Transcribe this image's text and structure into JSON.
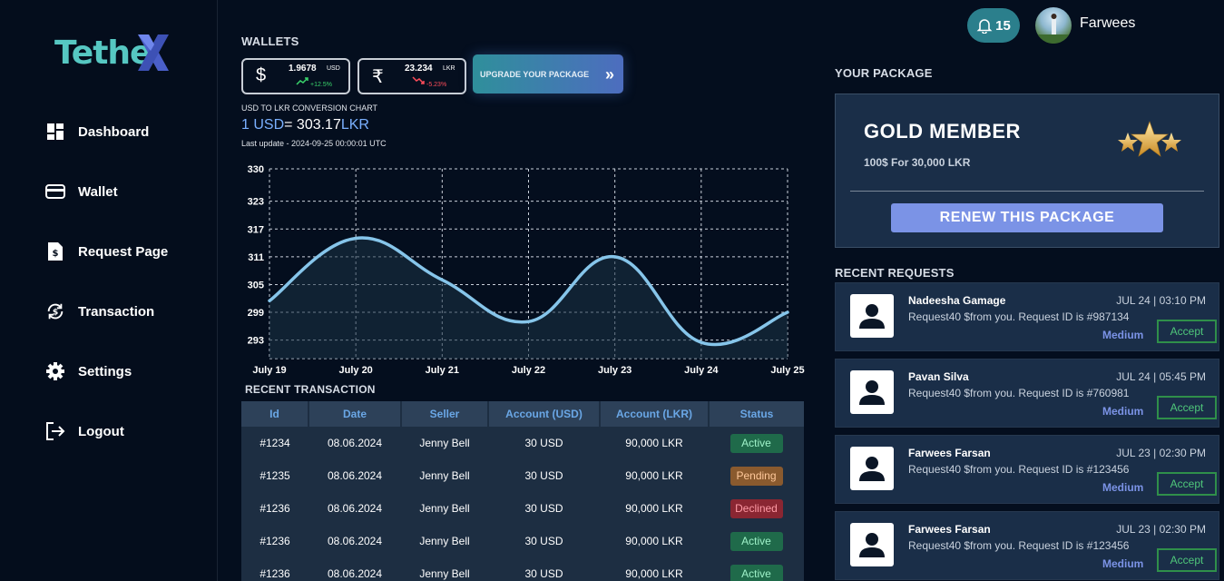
{
  "app": {
    "logo_text": "Tethe",
    "logo_letter": "X"
  },
  "sidebar": {
    "items": [
      {
        "label": "Dashboard",
        "icon": "dashboard-icon"
      },
      {
        "label": "Wallet",
        "icon": "wallet-icon"
      },
      {
        "label": "Request Page",
        "icon": "request-page-icon"
      },
      {
        "label": "Transaction",
        "icon": "transaction-icon"
      },
      {
        "label": "Settings",
        "icon": "settings-icon"
      },
      {
        "label": "Logout",
        "icon": "logout-icon"
      }
    ]
  },
  "wallets": {
    "title": "WALLETS",
    "cards": [
      {
        "symbol": "$",
        "amount": "1.9678",
        "currency": "USD",
        "change": "+12.5%",
        "change_color": "#39d36b"
      },
      {
        "symbol": "₹",
        "amount": "23.234",
        "currency": "LKR",
        "change": "-5.23%",
        "change_color": "#ff4d5a"
      }
    ],
    "upgrade_label": "UPGRADE YOUR PACKAGE"
  },
  "conversion": {
    "title": "USD TO LKR CONVERSION CHART",
    "from": "1 USD",
    "eq": "= 303.17",
    "to": "LKR",
    "last_update": "Last update - 2024-09-25 00:00:01 UTC"
  },
  "chart_data": {
    "type": "area",
    "categories": [
      "July 19",
      "July 20",
      "July 21",
      "July 22",
      "July 23",
      "July 24",
      "July 25"
    ],
    "y_ticks": [
      330,
      323,
      317,
      311,
      305,
      299,
      293
    ],
    "ylim": [
      289,
      330
    ],
    "series": [
      {
        "values": [
          301.5,
          315,
          306,
          297,
          311,
          292.5,
          299
        ]
      }
    ],
    "line_color": "#86c5ea",
    "grid": true
  },
  "transactions": {
    "title": "RECENT TRANSACTION",
    "columns": [
      "Id",
      "Date",
      "Seller",
      "Account (USD)",
      "Account (LKR)",
      "Status"
    ],
    "rows": [
      {
        "id": "#1234",
        "date": "08.06.2024",
        "seller": "Jenny Bell",
        "usd": "30 USD",
        "lkr": "90,000 LKR",
        "status": "Active",
        "kind": "active"
      },
      {
        "id": "#1235",
        "date": "08.06.2024",
        "seller": "Jenny Bell",
        "usd": "30 USD",
        "lkr": "90,000 LKR",
        "status": "Pending",
        "kind": "pending"
      },
      {
        "id": "#1236",
        "date": "08.06.2024",
        "seller": "Jenny Bell",
        "usd": "30 USD",
        "lkr": "90,000 LKR",
        "status": "Declined",
        "kind": "declined"
      },
      {
        "id": "#1236",
        "date": "08.06.2024",
        "seller": "Jenny Bell",
        "usd": "30 USD",
        "lkr": "90,000 LKR",
        "status": "Active",
        "kind": "active"
      },
      {
        "id": "#1236",
        "date": "08.06.2024",
        "seller": "Jenny Bell",
        "usd": "30 USD",
        "lkr": "90,000 LKR",
        "status": "Active",
        "kind": "active"
      }
    ]
  },
  "header": {
    "notification_count": "15",
    "user_name": "Farwees"
  },
  "package": {
    "title": "YOUR PACKAGE",
    "name": "GOLD MEMBER",
    "price": "100$ For 30,000 LKR",
    "renew_label": "RENEW THIS PACKAGE"
  },
  "requests": {
    "title": "RECENT REQUESTS",
    "accept_label": "Accept",
    "items": [
      {
        "name": "Nadeesha Gamage",
        "time": "JUL 24 | 03:10 PM",
        "message": "Request40 $from you. Request ID is #987134",
        "priority": "Medium"
      },
      {
        "name": "Pavan Silva",
        "time": "JUL 24 | 05:45 PM",
        "message": "Request40 $from you. Request ID is #760981",
        "priority": "Medium"
      },
      {
        "name": "Farwees Farsan",
        "time": "JUL 23 | 02:30 PM",
        "message": "Request40 $from you. Request ID is #123456",
        "priority": "Medium"
      },
      {
        "name": "Farwees Farsan",
        "time": "JUL 23 | 02:30 PM",
        "message": "Request40 $from you. Request ID is #123456",
        "priority": "Medium"
      }
    ]
  }
}
